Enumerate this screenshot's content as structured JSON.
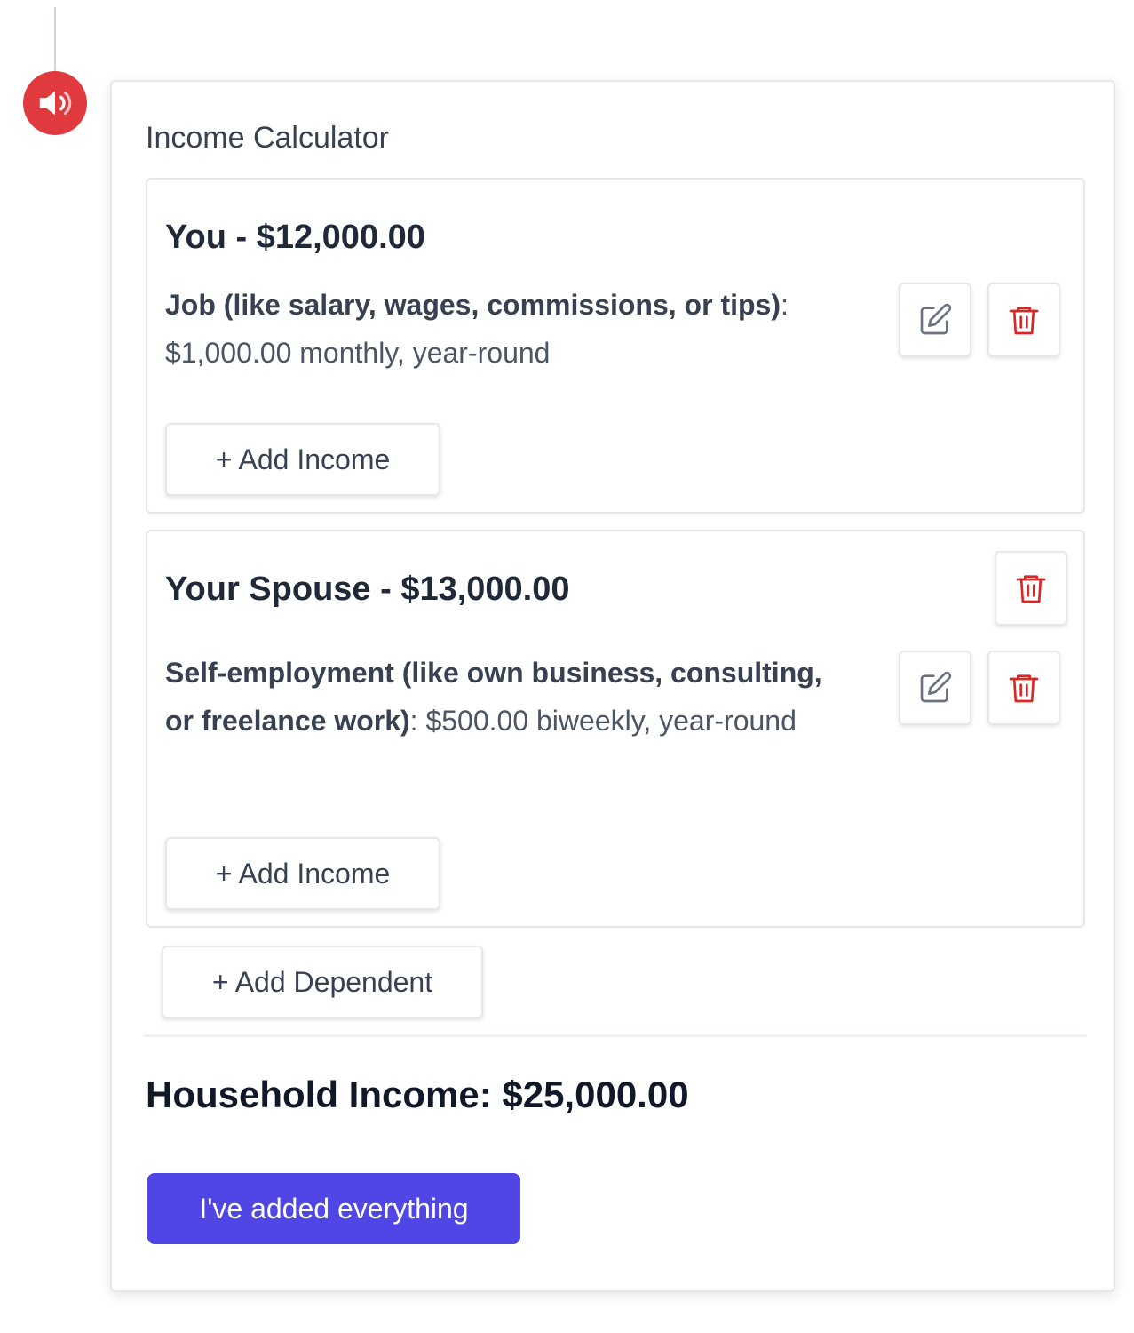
{
  "calculator": {
    "title": "Income Calculator",
    "people": [
      {
        "heading": "You - $12,000.00",
        "incomes": [
          {
            "type": "Job (like salary, wages, commissions, or tips)",
            "detail": ": $1,000.00 monthly, year-round"
          }
        ],
        "add_income_label": "+ Add Income"
      },
      {
        "heading": "Your Spouse - $13,000.00",
        "incomes": [
          {
            "type": "Self-employment (like own business, consulting, or freelance work)",
            "detail": ": $500.00 biweekly, year-round"
          }
        ],
        "add_income_label": "+ Add Income"
      }
    ],
    "add_dependent_label": "+ Add Dependent",
    "household_income": "Household Income: $25,000.00",
    "submit_label": "I've added everything"
  },
  "icons": {
    "speaker": "speaker-icon",
    "edit": "edit-icon",
    "delete": "trash-icon"
  },
  "colors": {
    "primary": "#4f46e5",
    "danger": "#dc2626",
    "avatar": "#e0393e"
  }
}
